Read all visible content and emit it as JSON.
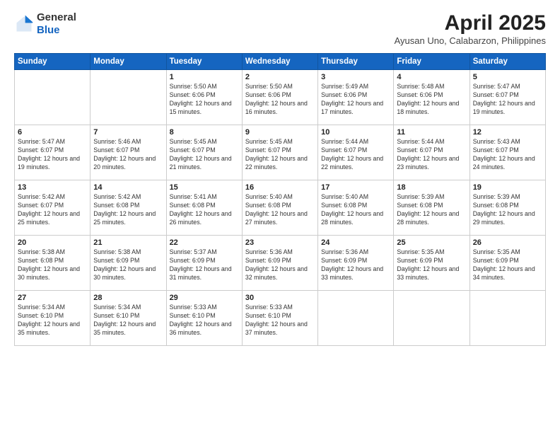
{
  "header": {
    "logo_line1": "General",
    "logo_line2": "Blue",
    "title": "April 2025",
    "subtitle": "Ayusan Uno, Calabarzon, Philippines"
  },
  "weekdays": [
    "Sunday",
    "Monday",
    "Tuesday",
    "Wednesday",
    "Thursday",
    "Friday",
    "Saturday"
  ],
  "weeks": [
    [
      {
        "day": "",
        "info": ""
      },
      {
        "day": "",
        "info": ""
      },
      {
        "day": "1",
        "info": "Sunrise: 5:50 AM\nSunset: 6:06 PM\nDaylight: 12 hours and 15 minutes."
      },
      {
        "day": "2",
        "info": "Sunrise: 5:50 AM\nSunset: 6:06 PM\nDaylight: 12 hours and 16 minutes."
      },
      {
        "day": "3",
        "info": "Sunrise: 5:49 AM\nSunset: 6:06 PM\nDaylight: 12 hours and 17 minutes."
      },
      {
        "day": "4",
        "info": "Sunrise: 5:48 AM\nSunset: 6:06 PM\nDaylight: 12 hours and 18 minutes."
      },
      {
        "day": "5",
        "info": "Sunrise: 5:47 AM\nSunset: 6:07 PM\nDaylight: 12 hours and 19 minutes."
      }
    ],
    [
      {
        "day": "6",
        "info": "Sunrise: 5:47 AM\nSunset: 6:07 PM\nDaylight: 12 hours and 19 minutes."
      },
      {
        "day": "7",
        "info": "Sunrise: 5:46 AM\nSunset: 6:07 PM\nDaylight: 12 hours and 20 minutes."
      },
      {
        "day": "8",
        "info": "Sunrise: 5:45 AM\nSunset: 6:07 PM\nDaylight: 12 hours and 21 minutes."
      },
      {
        "day": "9",
        "info": "Sunrise: 5:45 AM\nSunset: 6:07 PM\nDaylight: 12 hours and 22 minutes."
      },
      {
        "day": "10",
        "info": "Sunrise: 5:44 AM\nSunset: 6:07 PM\nDaylight: 12 hours and 22 minutes."
      },
      {
        "day": "11",
        "info": "Sunrise: 5:44 AM\nSunset: 6:07 PM\nDaylight: 12 hours and 23 minutes."
      },
      {
        "day": "12",
        "info": "Sunrise: 5:43 AM\nSunset: 6:07 PM\nDaylight: 12 hours and 24 minutes."
      }
    ],
    [
      {
        "day": "13",
        "info": "Sunrise: 5:42 AM\nSunset: 6:07 PM\nDaylight: 12 hours and 25 minutes."
      },
      {
        "day": "14",
        "info": "Sunrise: 5:42 AM\nSunset: 6:08 PM\nDaylight: 12 hours and 25 minutes."
      },
      {
        "day": "15",
        "info": "Sunrise: 5:41 AM\nSunset: 6:08 PM\nDaylight: 12 hours and 26 minutes."
      },
      {
        "day": "16",
        "info": "Sunrise: 5:40 AM\nSunset: 6:08 PM\nDaylight: 12 hours and 27 minutes."
      },
      {
        "day": "17",
        "info": "Sunrise: 5:40 AM\nSunset: 6:08 PM\nDaylight: 12 hours and 28 minutes."
      },
      {
        "day": "18",
        "info": "Sunrise: 5:39 AM\nSunset: 6:08 PM\nDaylight: 12 hours and 28 minutes."
      },
      {
        "day": "19",
        "info": "Sunrise: 5:39 AM\nSunset: 6:08 PM\nDaylight: 12 hours and 29 minutes."
      }
    ],
    [
      {
        "day": "20",
        "info": "Sunrise: 5:38 AM\nSunset: 6:08 PM\nDaylight: 12 hours and 30 minutes."
      },
      {
        "day": "21",
        "info": "Sunrise: 5:38 AM\nSunset: 6:09 PM\nDaylight: 12 hours and 30 minutes."
      },
      {
        "day": "22",
        "info": "Sunrise: 5:37 AM\nSunset: 6:09 PM\nDaylight: 12 hours and 31 minutes."
      },
      {
        "day": "23",
        "info": "Sunrise: 5:36 AM\nSunset: 6:09 PM\nDaylight: 12 hours and 32 minutes."
      },
      {
        "day": "24",
        "info": "Sunrise: 5:36 AM\nSunset: 6:09 PM\nDaylight: 12 hours and 33 minutes."
      },
      {
        "day": "25",
        "info": "Sunrise: 5:35 AM\nSunset: 6:09 PM\nDaylight: 12 hours and 33 minutes."
      },
      {
        "day": "26",
        "info": "Sunrise: 5:35 AM\nSunset: 6:09 PM\nDaylight: 12 hours and 34 minutes."
      }
    ],
    [
      {
        "day": "27",
        "info": "Sunrise: 5:34 AM\nSunset: 6:10 PM\nDaylight: 12 hours and 35 minutes."
      },
      {
        "day": "28",
        "info": "Sunrise: 5:34 AM\nSunset: 6:10 PM\nDaylight: 12 hours and 35 minutes."
      },
      {
        "day": "29",
        "info": "Sunrise: 5:33 AM\nSunset: 6:10 PM\nDaylight: 12 hours and 36 minutes."
      },
      {
        "day": "30",
        "info": "Sunrise: 5:33 AM\nSunset: 6:10 PM\nDaylight: 12 hours and 37 minutes."
      },
      {
        "day": "",
        "info": ""
      },
      {
        "day": "",
        "info": ""
      },
      {
        "day": "",
        "info": ""
      }
    ]
  ]
}
